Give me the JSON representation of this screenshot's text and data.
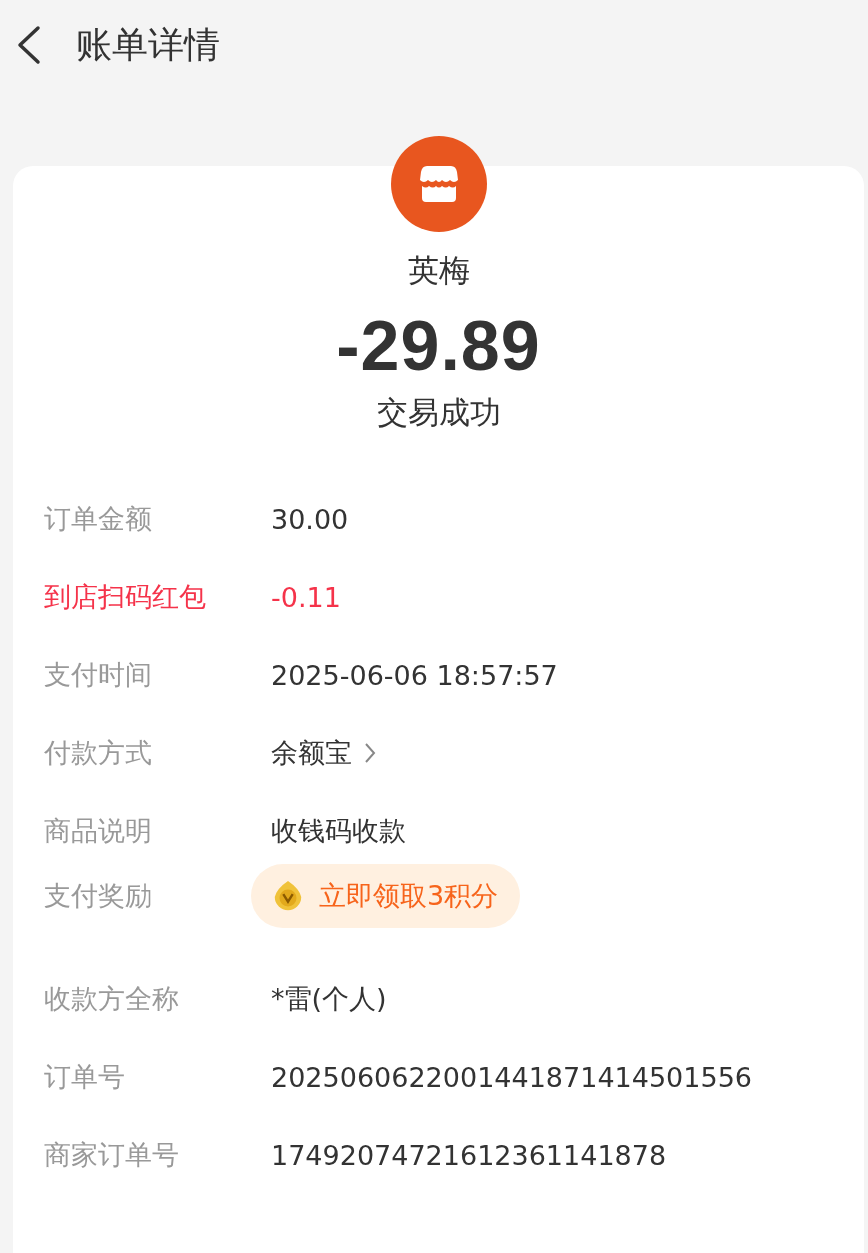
{
  "header": {
    "title": "账单详情"
  },
  "merchant": {
    "name": "英梅",
    "amount": "-29.89",
    "status": "交易成功"
  },
  "rows": [
    {
      "kind": "plain",
      "label": "订单金额",
      "value": "30.00"
    },
    {
      "kind": "discount",
      "label": "到店扫码红包",
      "value": "-0.11"
    },
    {
      "kind": "plain",
      "label": "支付时间",
      "value": "2025-06-06 18:57:57"
    },
    {
      "kind": "link",
      "label": "付款方式",
      "value": "余额宝"
    },
    {
      "kind": "plain",
      "label": "商品说明",
      "value": "收钱码收款"
    },
    {
      "kind": "reward",
      "label": "支付奖励",
      "value": "立即领取3积分"
    },
    {
      "kind": "plain",
      "label": "收款方全称",
      "value": "*雷(个人)"
    },
    {
      "kind": "plain",
      "label": "订单号",
      "value": "2025060622001441871414501556"
    },
    {
      "kind": "plain",
      "label": "商家订单号",
      "value": "17492074721612361141878"
    }
  ]
}
